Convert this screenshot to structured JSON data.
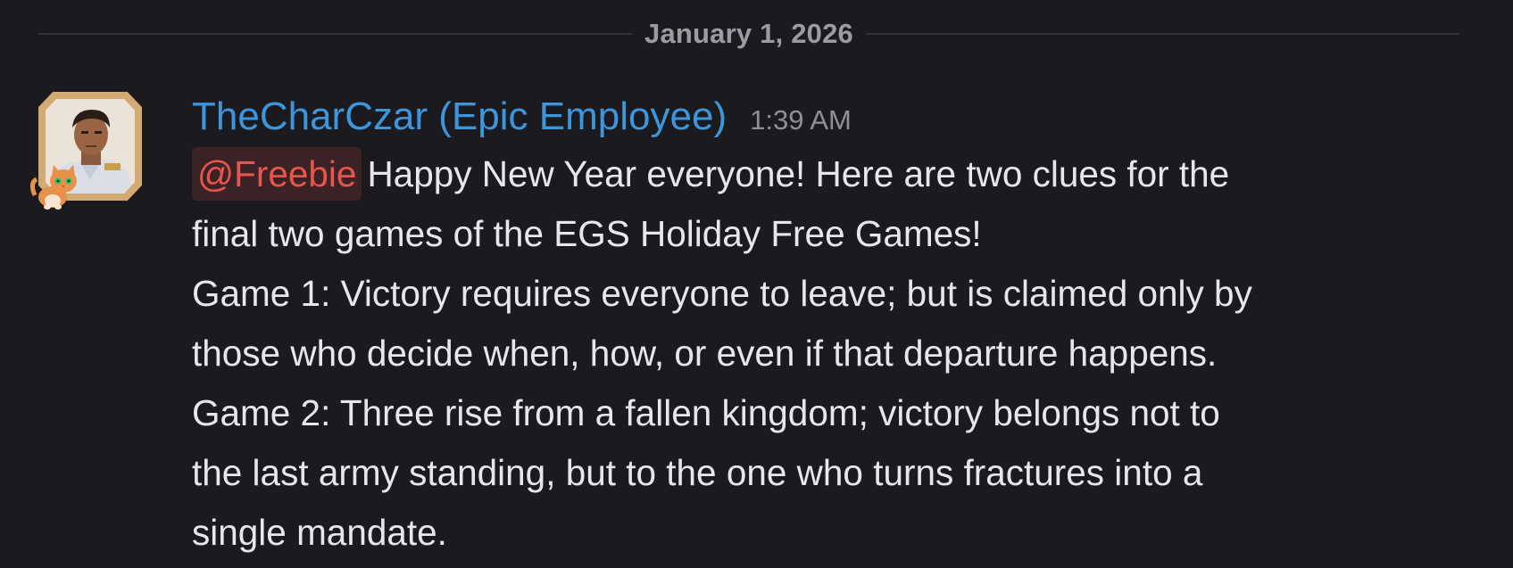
{
  "date_divider": {
    "label": "January 1, 2026"
  },
  "message": {
    "author": {
      "name": "TheCharCzar (Epic Employee)",
      "avatar_icon": "avatar-portrait-icon",
      "avatar_decoration_icon": "cat-avatar-decoration-icon"
    },
    "timestamp": "1:39 AM",
    "mention": "@Freebie",
    "lines": [
      "Happy New Year everyone! Here are two clues for the",
      "final two games of the EGS Holiday Free Games!",
      "Game 1: Victory requires everyone to leave; but is claimed only by",
      "those who decide when, how, or even if that departure happens.",
      "Game 2: Three rise from a fallen kingdom; victory belongs not to",
      "the last army standing, but to the one who turns fractures into a",
      "single mandate."
    ]
  },
  "colors": {
    "background": "#1b1b1f",
    "username": "#3d96dc",
    "mention_text": "#e6564a",
    "mention_bg": "#3a2226",
    "body_text": "#e6e6eb",
    "muted_text": "#8f8f98"
  }
}
